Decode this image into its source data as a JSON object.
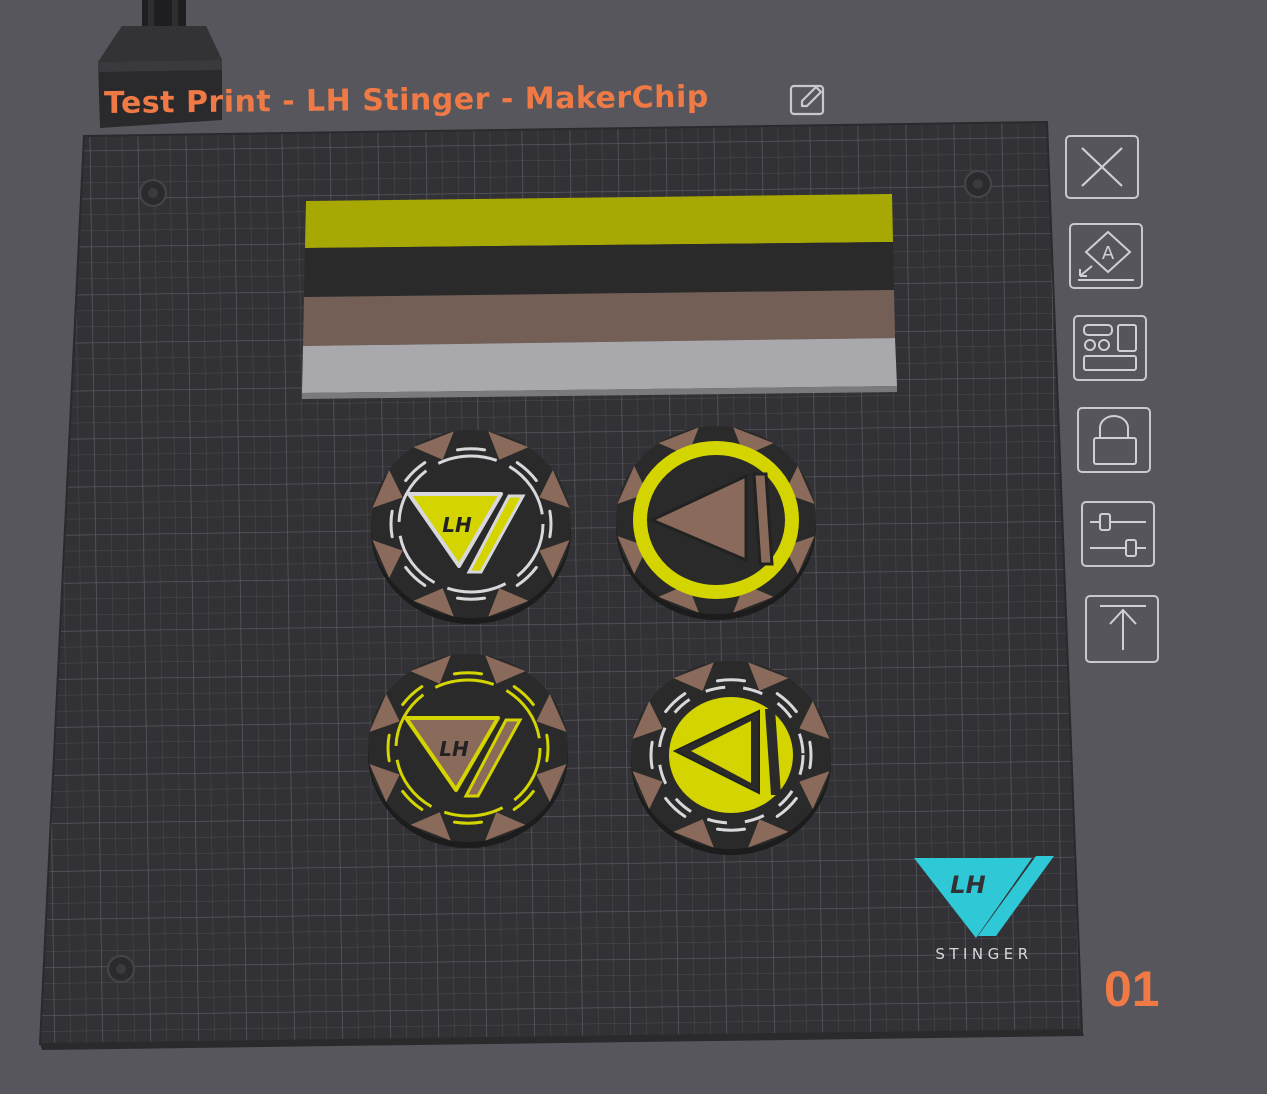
{
  "plate": {
    "title": "Test Print - LH Stinger - MakerChip",
    "number": "01"
  },
  "logo": {
    "text": "STINGER",
    "mark": "LH",
    "color": "#2ec8d6"
  },
  "toolbar": {
    "buttons": [
      {
        "name": "close-plate-button",
        "icon": "close-icon"
      },
      {
        "name": "auto-orient-button",
        "icon": "auto-orient-icon"
      },
      {
        "name": "arrange-button",
        "icon": "arrange-icon"
      },
      {
        "name": "lock-plate-button",
        "icon": "lock-icon"
      },
      {
        "name": "plate-settings-button",
        "icon": "sliders-icon"
      },
      {
        "name": "move-to-top-button",
        "icon": "arrow-up-icon"
      }
    ]
  },
  "colors": {
    "title": "#f07a45",
    "filament_yellow": "#d4d400",
    "filament_black": "#2a2a2a",
    "filament_brown": "#8a6a5a",
    "filament_white": "#d8d8dc"
  },
  "objects": {
    "wipe_tower_stripes": [
      "yellow",
      "black",
      "brown",
      "white"
    ],
    "chips": [
      {
        "name": "chip-top-left",
        "mark": "LH"
      },
      {
        "name": "chip-top-right",
        "mark": ""
      },
      {
        "name": "chip-bottom-left",
        "mark": "LH"
      },
      {
        "name": "chip-bottom-right",
        "mark": ""
      }
    ]
  }
}
